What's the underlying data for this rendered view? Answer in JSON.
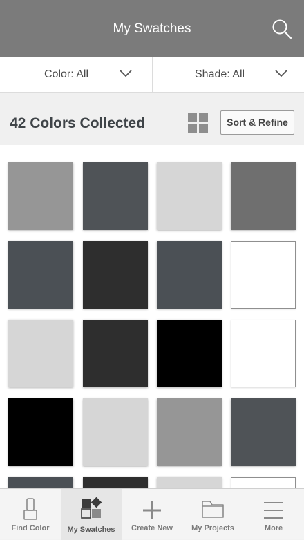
{
  "header": {
    "title": "My Swatches"
  },
  "filters": {
    "color_label": "Color: All",
    "shade_label": "Shade: All"
  },
  "collection": {
    "count_text": "42 Colors Collected",
    "sort_label": "Sort & Refine"
  },
  "swatches": [
    {
      "color": "#969696"
    },
    {
      "color": "#4f5357"
    },
    {
      "color": "#d6d6d6"
    },
    {
      "color": "#6f6f6f"
    },
    {
      "color": "#4b5055"
    },
    {
      "color": "#2e2e2e"
    },
    {
      "color": "#4b5055"
    },
    {
      "color": "#ffffff"
    },
    {
      "color": "#d6d6d6"
    },
    {
      "color": "#2e2e2e"
    },
    {
      "color": "#000000"
    },
    {
      "color": "#ffffff"
    },
    {
      "color": "#000000"
    },
    {
      "color": "#d6d6d6"
    },
    {
      "color": "#969696"
    },
    {
      "color": "#4f5357"
    },
    {
      "color": "#4b5055"
    },
    {
      "color": "#2e2e2e"
    },
    {
      "color": "#d6d6d6"
    },
    {
      "color": "#ffffff"
    }
  ],
  "bottom_nav": {
    "items": [
      {
        "label": "Find Color",
        "icon": "paintbrush-icon"
      },
      {
        "label": "My Swatches",
        "icon": "swatches-icon"
      },
      {
        "label": "Create New",
        "icon": "plus-icon"
      },
      {
        "label": "My Projects",
        "icon": "folder-icon"
      },
      {
        "label": "More",
        "icon": "menu-icon"
      }
    ]
  }
}
